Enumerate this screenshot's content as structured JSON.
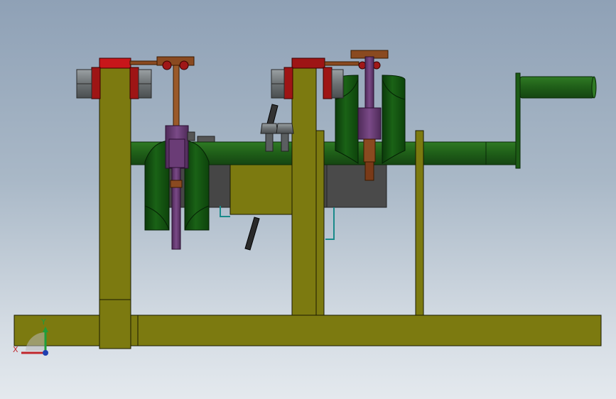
{
  "viewport": {
    "background_top": "#8fa1b6",
    "background_bottom": "#e4e9ee"
  },
  "triad": {
    "x_label": "X",
    "y_label": "Y",
    "x_color": "#c1272d",
    "y_color": "#1f9e3a",
    "z_color": "#1f3fb0"
  },
  "colors": {
    "frame": "#7c7a10",
    "shaft": "#1d5c16",
    "roller": "#0f4a0d",
    "rod": "#6a3c76",
    "lever": "#8a4a20",
    "block": "#9e1515",
    "nut": "#707476",
    "housing": "#454545",
    "bracket": "#1a8a8a"
  }
}
